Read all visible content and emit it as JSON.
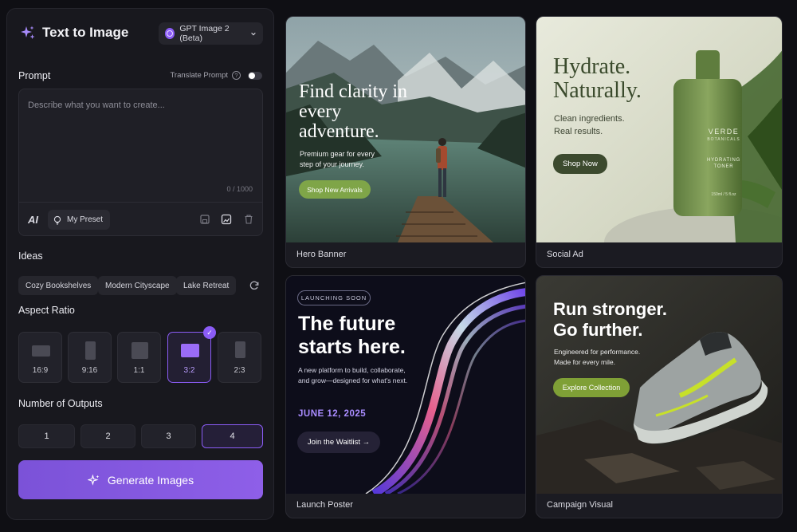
{
  "app": {
    "title": "Text to Image",
    "model": "GPT Image 2 (Beta)"
  },
  "prompt": {
    "label": "Prompt",
    "translate_label": "Translate Prompt",
    "placeholder": "Describe what you want to create...",
    "counter": "0 / 1000",
    "preset_label": "My Preset"
  },
  "ideas": {
    "label": "Ideas",
    "chips": [
      "Cozy Bookshelves",
      "Modern Cityscape",
      "Lake Retreat"
    ]
  },
  "aspect_ratio": {
    "label": "Aspect Ratio",
    "options": [
      "16:9",
      "9:16",
      "1:1",
      "3:2",
      "2:3"
    ],
    "selected": "3:2"
  },
  "outputs": {
    "label": "Number of Outputs",
    "options": [
      "1",
      "2",
      "3",
      "4"
    ],
    "selected": "4"
  },
  "generate": {
    "label": "Generate Images"
  },
  "gallery": [
    {
      "caption": "Hero Banner",
      "headline": "Find clarity in every adventure.",
      "sub": "Premium gear for every step of your journey.",
      "cta": "Shop New Arrivals"
    },
    {
      "caption": "Social Ad",
      "headline": "Hydrate. Naturally.",
      "sub": "Clean ingredients. Real results.",
      "cta": "Shop Now",
      "brand": "VERDE",
      "brand_sub": "BOTANICALS",
      "product": "HYDRATING TONER",
      "volume": "150ml / 5 fl.oz"
    },
    {
      "caption": "Launch Poster",
      "tag": "LAUNCHING SOON",
      "headline": "The future starts here.",
      "sub": "A new platform to build, collaborate, and grow—designed for what's next.",
      "date": "JUNE 12, 2025",
      "cta": "Join the Waitlist →"
    },
    {
      "caption": "Campaign Visual",
      "headline": "Run stronger. Go further.",
      "sub": "Engineered for performance. Made for every mile.",
      "cta": "Explore Collection"
    }
  ],
  "colors": {
    "accent": "#8b5cf6",
    "panel": "#18181e",
    "background": "#0f0f14"
  }
}
